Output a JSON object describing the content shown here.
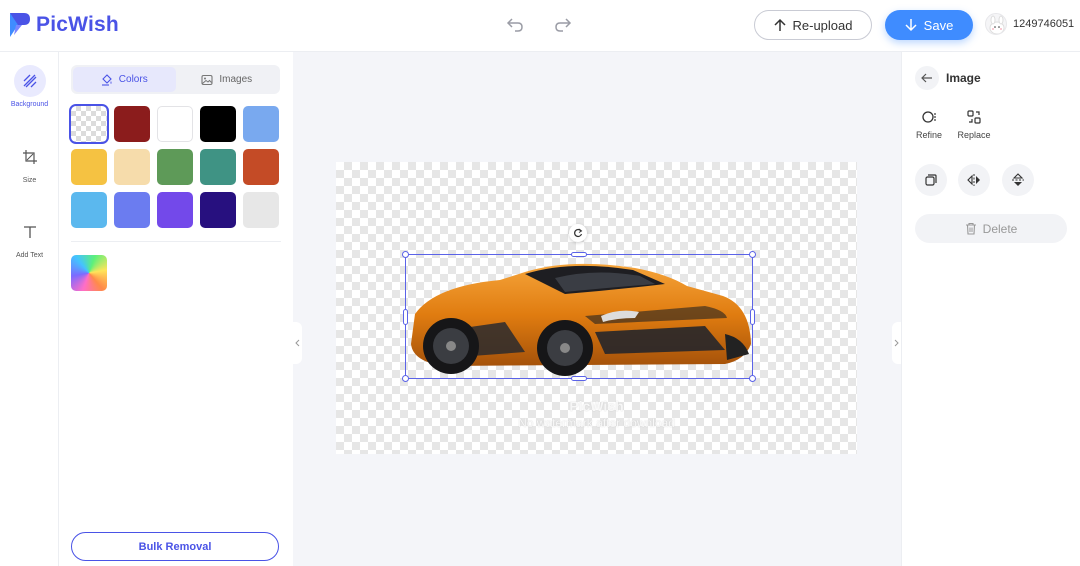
{
  "app": {
    "name": "PicWish",
    "brand_color": "#4a53e6",
    "accent_color": "#3f8cff"
  },
  "header": {
    "undo_icon": "undo-icon",
    "redo_icon": "redo-icon",
    "reupload_label": "Re-upload",
    "save_label": "Save",
    "user_id": "1249746051"
  },
  "rail": {
    "items": [
      {
        "label": "Background",
        "icon": "background-icon",
        "active": true
      },
      {
        "label": "Size",
        "icon": "crop-icon",
        "active": false
      },
      {
        "label": "Add Text",
        "icon": "text-icon",
        "active": false
      }
    ]
  },
  "panel": {
    "tabs": [
      {
        "label": "Colors",
        "active": true
      },
      {
        "label": "Images",
        "active": false
      }
    ],
    "swatches": [
      "transparent",
      "#8b1c1c",
      "#ffffff",
      "#000000",
      "#79a9ef",
      "#f5c242",
      "#f6dcab",
      "#5e9a58",
      "#3f9384",
      "#c44b26",
      "#5bb8ee",
      "#6b7cf0",
      "#7349ea",
      "#27107f",
      "#e7e7e7"
    ],
    "bulk_label": "Bulk Removal"
  },
  "canvas": {
    "watermark_title": "PicWish",
    "watermark_sub": "No watermark after download"
  },
  "right": {
    "title": "Image",
    "tools": [
      {
        "label": "Refine",
        "icon": "refine-icon"
      },
      {
        "label": "Replace",
        "icon": "replace-icon"
      }
    ],
    "actions": [
      "duplicate-icon",
      "flip-horizontal-icon",
      "flip-vertical-icon"
    ],
    "delete_label": "Delete"
  }
}
